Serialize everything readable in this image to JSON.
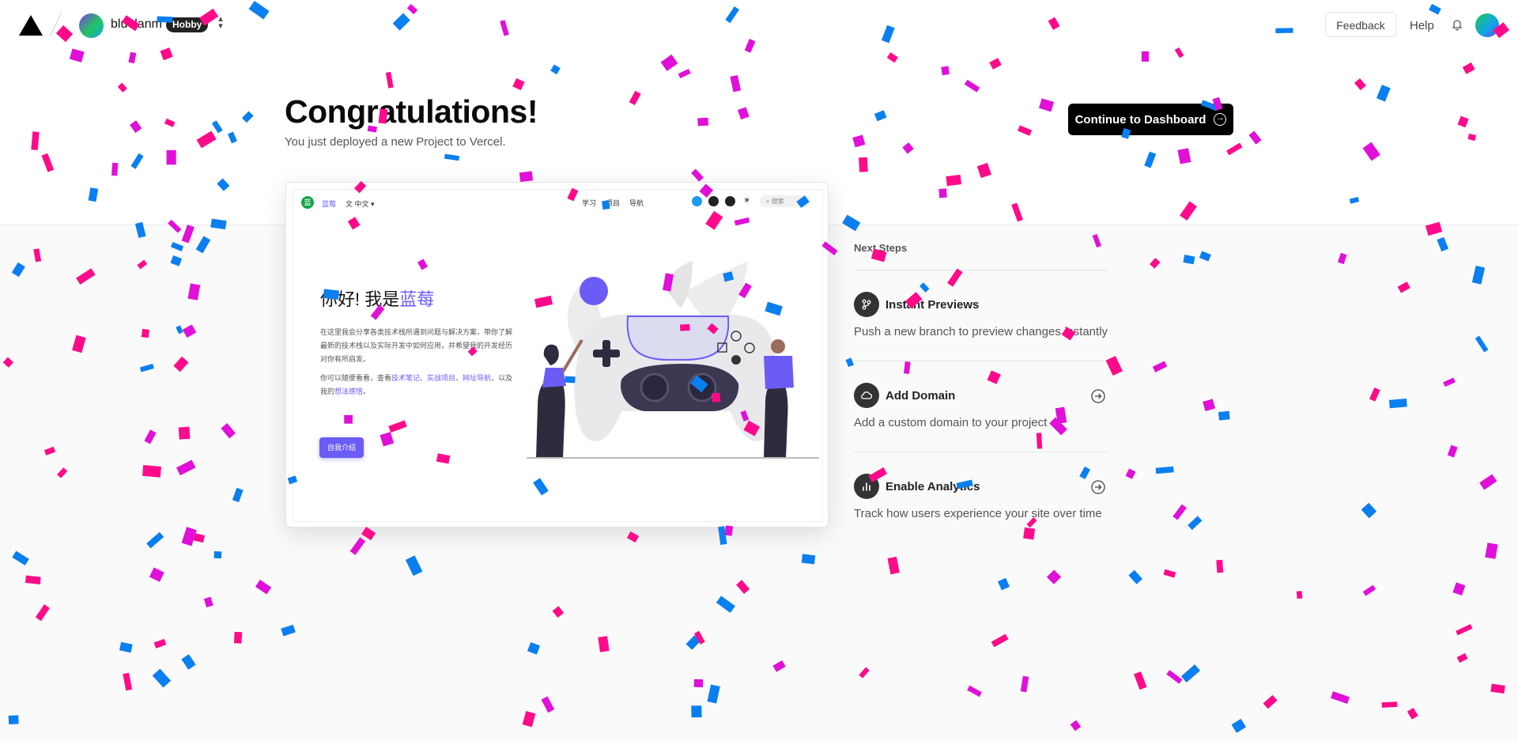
{
  "header": {
    "team_name": "bluelanm",
    "plan_badge": "Hobby",
    "feedback_label": "Feedback",
    "help_label": "Help"
  },
  "hero": {
    "title": "Congratulations!",
    "subtitle": "You just deployed a new Project to Vercel.",
    "continue_label": "Continue to Dashboard"
  },
  "preview": {
    "brand": "蓝莓",
    "lang": "中文",
    "nav": [
      "学习",
      "项目",
      "导航"
    ],
    "search": "搜索",
    "heading_prefix": "你好! 我是",
    "heading_accent": "蓝莓",
    "para1": "在这里我会分享各类技术栈所遇到问题与解决方案，带你了解最新的技术栈以及实际开发中如何应用，并希望我的开发经历对你有所启发。",
    "para2_prefix": "你可以随便看看，查看",
    "para2_link1": "技术笔记",
    "para2_sep1": "、",
    "para2_link2": "实战项目",
    "para2_sep2": "、",
    "para2_link3": "网址导航",
    "para2_mid": "，以及我的",
    "para2_link4": "想法感悟",
    "para2_end": "。",
    "button": "自我介绍"
  },
  "next_steps": {
    "title": "Next Steps",
    "items": [
      {
        "title": "Instant Previews",
        "description": "Push a new branch to preview changes instantly",
        "icon": "branch-icon"
      },
      {
        "title": "Add Domain",
        "description": "Add a custom domain to your project",
        "icon": "cloud-icon"
      },
      {
        "title": "Enable Analytics",
        "description": "Track how users experience your site over time",
        "icon": "analytics-icon"
      }
    ]
  },
  "colors": {
    "accent": "#6b5cf6",
    "confetti_pink": "#ff0a8a",
    "confetti_magenta": "#e010d8",
    "confetti_blue": "#0a7ff0"
  }
}
